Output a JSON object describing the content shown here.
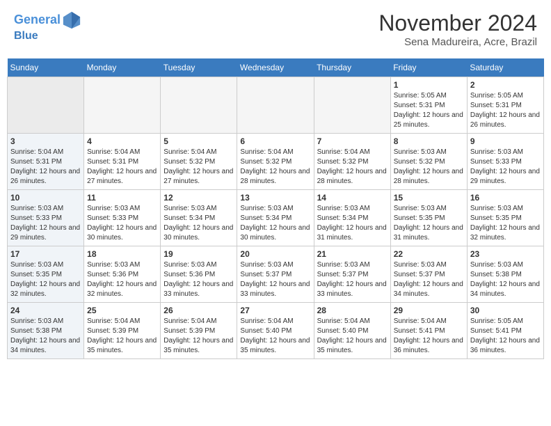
{
  "header": {
    "logo_line1": "General",
    "logo_line2": "Blue",
    "month": "November 2024",
    "location": "Sena Madureira, Acre, Brazil"
  },
  "weekdays": [
    "Sunday",
    "Monday",
    "Tuesday",
    "Wednesday",
    "Thursday",
    "Friday",
    "Saturday"
  ],
  "weeks": [
    [
      {
        "day": "",
        "empty": true
      },
      {
        "day": "",
        "empty": true
      },
      {
        "day": "",
        "empty": true
      },
      {
        "day": "",
        "empty": true
      },
      {
        "day": "",
        "empty": true
      },
      {
        "day": "1",
        "sunrise": "5:05 AM",
        "sunset": "5:31 PM",
        "daylight": "12 hours and 25 minutes."
      },
      {
        "day": "2",
        "sunrise": "5:05 AM",
        "sunset": "5:31 PM",
        "daylight": "12 hours and 26 minutes."
      }
    ],
    [
      {
        "day": "3",
        "sunrise": "5:04 AM",
        "sunset": "5:31 PM",
        "daylight": "12 hours and 26 minutes."
      },
      {
        "day": "4",
        "sunrise": "5:04 AM",
        "sunset": "5:31 PM",
        "daylight": "12 hours and 27 minutes."
      },
      {
        "day": "5",
        "sunrise": "5:04 AM",
        "sunset": "5:32 PM",
        "daylight": "12 hours and 27 minutes."
      },
      {
        "day": "6",
        "sunrise": "5:04 AM",
        "sunset": "5:32 PM",
        "daylight": "12 hours and 28 minutes."
      },
      {
        "day": "7",
        "sunrise": "5:04 AM",
        "sunset": "5:32 PM",
        "daylight": "12 hours and 28 minutes."
      },
      {
        "day": "8",
        "sunrise": "5:03 AM",
        "sunset": "5:32 PM",
        "daylight": "12 hours and 28 minutes."
      },
      {
        "day": "9",
        "sunrise": "5:03 AM",
        "sunset": "5:33 PM",
        "daylight": "12 hours and 29 minutes."
      }
    ],
    [
      {
        "day": "10",
        "sunrise": "5:03 AM",
        "sunset": "5:33 PM",
        "daylight": "12 hours and 29 minutes."
      },
      {
        "day": "11",
        "sunrise": "5:03 AM",
        "sunset": "5:33 PM",
        "daylight": "12 hours and 30 minutes."
      },
      {
        "day": "12",
        "sunrise": "5:03 AM",
        "sunset": "5:34 PM",
        "daylight": "12 hours and 30 minutes."
      },
      {
        "day": "13",
        "sunrise": "5:03 AM",
        "sunset": "5:34 PM",
        "daylight": "12 hours and 30 minutes."
      },
      {
        "day": "14",
        "sunrise": "5:03 AM",
        "sunset": "5:34 PM",
        "daylight": "12 hours and 31 minutes."
      },
      {
        "day": "15",
        "sunrise": "5:03 AM",
        "sunset": "5:35 PM",
        "daylight": "12 hours and 31 minutes."
      },
      {
        "day": "16",
        "sunrise": "5:03 AM",
        "sunset": "5:35 PM",
        "daylight": "12 hours and 32 minutes."
      }
    ],
    [
      {
        "day": "17",
        "sunrise": "5:03 AM",
        "sunset": "5:35 PM",
        "daylight": "12 hours and 32 minutes."
      },
      {
        "day": "18",
        "sunrise": "5:03 AM",
        "sunset": "5:36 PM",
        "daylight": "12 hours and 32 minutes."
      },
      {
        "day": "19",
        "sunrise": "5:03 AM",
        "sunset": "5:36 PM",
        "daylight": "12 hours and 33 minutes."
      },
      {
        "day": "20",
        "sunrise": "5:03 AM",
        "sunset": "5:37 PM",
        "daylight": "12 hours and 33 minutes."
      },
      {
        "day": "21",
        "sunrise": "5:03 AM",
        "sunset": "5:37 PM",
        "daylight": "12 hours and 33 minutes."
      },
      {
        "day": "22",
        "sunrise": "5:03 AM",
        "sunset": "5:37 PM",
        "daylight": "12 hours and 34 minutes."
      },
      {
        "day": "23",
        "sunrise": "5:03 AM",
        "sunset": "5:38 PM",
        "daylight": "12 hours and 34 minutes."
      }
    ],
    [
      {
        "day": "24",
        "sunrise": "5:03 AM",
        "sunset": "5:38 PM",
        "daylight": "12 hours and 34 minutes."
      },
      {
        "day": "25",
        "sunrise": "5:04 AM",
        "sunset": "5:39 PM",
        "daylight": "12 hours and 35 minutes."
      },
      {
        "day": "26",
        "sunrise": "5:04 AM",
        "sunset": "5:39 PM",
        "daylight": "12 hours and 35 minutes."
      },
      {
        "day": "27",
        "sunrise": "5:04 AM",
        "sunset": "5:40 PM",
        "daylight": "12 hours and 35 minutes."
      },
      {
        "day": "28",
        "sunrise": "5:04 AM",
        "sunset": "5:40 PM",
        "daylight": "12 hours and 35 minutes."
      },
      {
        "day": "29",
        "sunrise": "5:04 AM",
        "sunset": "5:41 PM",
        "daylight": "12 hours and 36 minutes."
      },
      {
        "day": "30",
        "sunrise": "5:05 AM",
        "sunset": "5:41 PM",
        "daylight": "12 hours and 36 minutes."
      }
    ]
  ]
}
